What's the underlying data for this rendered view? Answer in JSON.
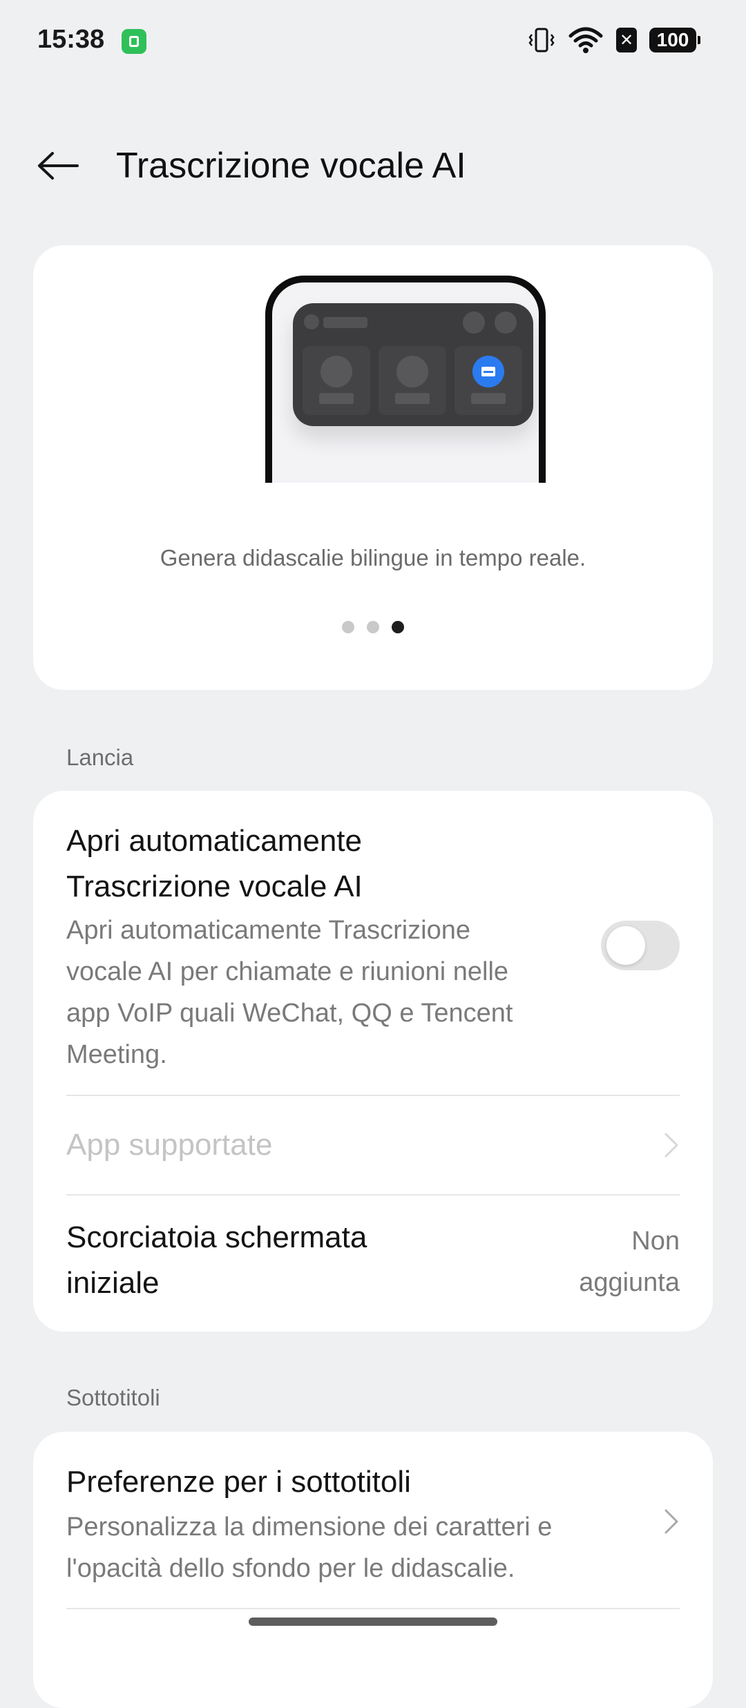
{
  "status_bar": {
    "time": "15:38",
    "app_icon": "app-notification-icon",
    "icons": [
      "vibrate-icon",
      "wifi-icon",
      "sim-off-icon"
    ],
    "sim_off_glyph": "✕",
    "battery": "100"
  },
  "header": {
    "title": "Trascrizione vocale AI",
    "back_icon": "back-arrow-icon"
  },
  "hero": {
    "caption": "Genera didascalie bilingue in tempo reale.",
    "page_count": 3,
    "active_page": 3,
    "illustration": "phone-call-overlay-illustration",
    "accent_color": "#2b7bf0"
  },
  "sections": {
    "launch": {
      "label": "Lancia",
      "auto_open": {
        "title_line1": "Apri automaticamente",
        "title_line2": "Trascrizione vocale AI",
        "desc_lines": [
          "Apri automaticamente Trascrizione",
          "vocale AI per chiamate e riunioni nelle",
          "app VoIP quali WeChat, QQ e Tencent",
          "Meeting."
        ],
        "enabled": false
      },
      "supported_apps": {
        "title": "App supportate",
        "disabled": true
      },
      "shortcut": {
        "title_line1": "Scorciatoia schermata",
        "title_line2": "iniziale",
        "value_line1": "Non",
        "value_line2": "aggiunta"
      }
    },
    "subtitles": {
      "label": "Sottotitoli",
      "preferences": {
        "title": "Preferenze per i sottotitoli",
        "desc_lines": [
          "Personalizza la dimensione dei caratteri e",
          "l'opacità dello sfondo per le didascalie."
        ]
      }
    }
  }
}
